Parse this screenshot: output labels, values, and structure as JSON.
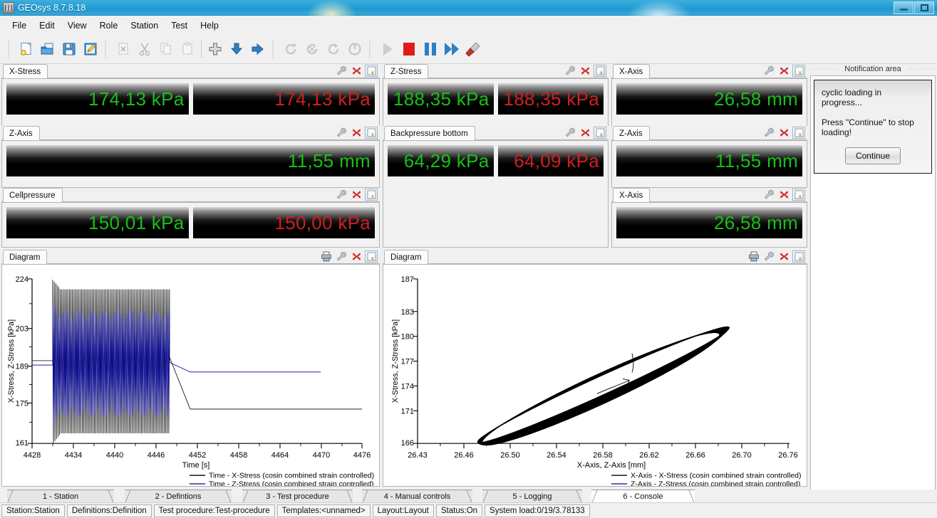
{
  "window": {
    "title": "GEOsys 8.7.8.18",
    "app_icon": "app-logo-icon",
    "minimize": "minimize-button",
    "restore": "restore-button"
  },
  "menu": {
    "items": [
      "File",
      "Edit",
      "View",
      "Role",
      "Station",
      "Test",
      "Help"
    ]
  },
  "toolbar": {
    "groups": [
      {
        "buttons": [
          {
            "name": "new-document-icon",
            "glyph": "new"
          },
          {
            "name": "open-folder-icon",
            "glyph": "open"
          },
          {
            "name": "save-icon",
            "glyph": "save"
          },
          {
            "name": "edit-document-icon",
            "glyph": "edit"
          }
        ]
      },
      {
        "buttons": [
          {
            "name": "delete-icon",
            "glyph": "delete"
          },
          {
            "name": "cut-scissors-icon",
            "glyph": "cut"
          },
          {
            "name": "copy-icon",
            "glyph": "copy"
          },
          {
            "name": "paste-icon",
            "glyph": "paste"
          }
        ]
      },
      {
        "buttons": [
          {
            "name": "add-plus-icon",
            "glyph": "plus"
          },
          {
            "name": "download-arrow-icon",
            "glyph": "down"
          },
          {
            "name": "forward-arrow-icon",
            "glyph": "right"
          }
        ]
      },
      {
        "buttons": [
          {
            "name": "refresh-disabled-icon",
            "glyph": "ref1"
          },
          {
            "name": "refresh-cancel-disabled-icon",
            "glyph": "ref2"
          },
          {
            "name": "refresh-alt-disabled-icon",
            "glyph": "ref3"
          },
          {
            "name": "power-disabled-icon",
            "glyph": "power"
          }
        ]
      },
      {
        "buttons": [
          {
            "name": "play-start-icon",
            "glyph": "play"
          },
          {
            "name": "stop-icon",
            "glyph": "stop"
          },
          {
            "name": "pause-icon",
            "glyph": "pause"
          },
          {
            "name": "fast-forward-icon",
            "glyph": "ffwd"
          },
          {
            "name": "tools-screwdriver-icon",
            "glyph": "screw"
          }
        ]
      }
    ]
  },
  "panels": [
    {
      "title": "X-Stress",
      "values": [
        {
          "text": "174,13 kPa",
          "color": "green"
        },
        {
          "text": "174,13 kPa",
          "color": "red"
        }
      ]
    },
    {
      "title": "Z-Axis",
      "values": [
        {
          "text": "11,55 mm",
          "color": "green"
        }
      ]
    },
    {
      "title": "Cellpressure",
      "values": [
        {
          "text": "150,01 kPa",
          "color": "green"
        },
        {
          "text": "150,00 kPa",
          "color": "red"
        }
      ]
    },
    {
      "title": "Z-Stress",
      "values": [
        {
          "text": "188,35 kPa",
          "color": "green"
        },
        {
          "text": "188,35 kPa",
          "color": "red"
        }
      ]
    },
    {
      "title": "Backpressure bottom",
      "values": [
        {
          "text": "64,29 kPa",
          "color": "green"
        },
        {
          "text": "64,09 kPa",
          "color": "red"
        }
      ]
    },
    {
      "title": "X-Axis",
      "values": [
        {
          "text": "26,58 mm",
          "color": "green"
        }
      ]
    },
    {
      "title": "Z-Axis",
      "values": [
        {
          "text": "11,55 mm",
          "color": "green"
        }
      ]
    },
    {
      "title": "X-Axis",
      "values": [
        {
          "text": "26,58 mm",
          "color": "green"
        }
      ]
    }
  ],
  "panel_tools": {
    "settings": "wrench-settings-icon",
    "close": "close-red-x-icon",
    "undock": "undock-window-icon",
    "print": "printer-icon"
  },
  "notification": {
    "header": "Notification area",
    "line1": "cyclic loading in progress...",
    "line2": "Press \"Continue\" to stop loading!",
    "button": "Continue"
  },
  "diagrams": [
    {
      "title": "Diagram"
    },
    {
      "title": "Diagram"
    }
  ],
  "chart_data": [
    {
      "type": "line",
      "title": "Diagram",
      "xlabel": "Time [s]",
      "ylabel": "X-Stress, Z-Stress [kPa]",
      "xlim": [
        4428,
        4476
      ],
      "ylim": [
        161,
        224
      ],
      "xticks": [
        4428,
        4434,
        4440,
        4446,
        4452,
        4458,
        4464,
        4470,
        4476
      ],
      "yticks": [
        161,
        175,
        189,
        203,
        224
      ],
      "grid": false,
      "legend_position": "bottom",
      "series": [
        {
          "name": "Time - X-Stress (cosin combined strain controlled)",
          "color": "#000000",
          "description": "High-amplitude cyclic oscillation from t=4431 to t=4448 between 168 and 220 kPa, then a ramp settling to a steady ~174 kPa plateau until t=4476",
          "cyclic_start": 4431,
          "cyclic_end": 4448,
          "cyclic_min": 168,
          "cyclic_max": 220,
          "plateau_value": 174.13
        },
        {
          "name": "Time - Z-Stress (cosin combined strain controlled)",
          "color": "#00008b",
          "description": "Cyclic oscillation from t=4431 to t=4448 between 172 and 212 kPa with a beating envelope, then a ramp settling to a steady ~188 kPa plateau ending at t=4470",
          "cyclic_start": 4431,
          "cyclic_end": 4448,
          "cyclic_min": 172,
          "cyclic_max": 212,
          "plateau_value": 188.35
        }
      ]
    },
    {
      "type": "line",
      "title": "Diagram",
      "xlabel": "X-Axis, Z-Axis [mm]",
      "ylabel": "X-Stress, Z-Stress [kPa]",
      "xlim": [
        26.41,
        26.78
      ],
      "ylim": [
        166,
        187
      ],
      "xticks": [
        26.43,
        26.46,
        26.5,
        26.54,
        26.58,
        26.62,
        26.66,
        26.7,
        26.76
      ],
      "yticks": [
        166,
        171,
        174,
        177,
        180,
        183,
        187
      ],
      "grid": false,
      "legend_position": "bottom",
      "series": [
        {
          "name": "X-Axis - X-Stress (cosin combined strain controlled)",
          "color": "#000000",
          "description": "Dense hysteresis loop (stacked stress-strain ellipses) tilted about 28 degrees, spanning x 26.47 to 26.72 mm and y 166 to 181 kPa",
          "loop_x_min": 26.47,
          "loop_x_max": 26.72,
          "loop_y_min": 166,
          "loop_y_max": 181
        },
        {
          "name": "Z-Axis - Z-Stress (cosin combined strain controlled)",
          "color": "#00008b",
          "description": "Overlaid hysteresis loop nearly coincident with the X series",
          "loop_x_min": 26.47,
          "loop_x_max": 26.72,
          "loop_y_min": 166,
          "loop_y_max": 181
        }
      ]
    }
  ],
  "bottom_tabs": [
    {
      "label": "1 - Station",
      "active": false
    },
    {
      "label": "2 - Defintions",
      "active": false
    },
    {
      "label": "3 - Test procedure",
      "active": false
    },
    {
      "label": "4 - Manual controls",
      "active": false
    },
    {
      "label": "5 - Logging",
      "active": false
    },
    {
      "label": "6 - Console",
      "active": true
    }
  ],
  "statusbar": {
    "cells": [
      "Station:Station",
      "Definitions:Definition",
      "Test procedure:Test-procedure",
      "Templates:<unnamed>",
      "Layout:Layout",
      "Status:On",
      "System load:0/19/3.78133"
    ]
  }
}
